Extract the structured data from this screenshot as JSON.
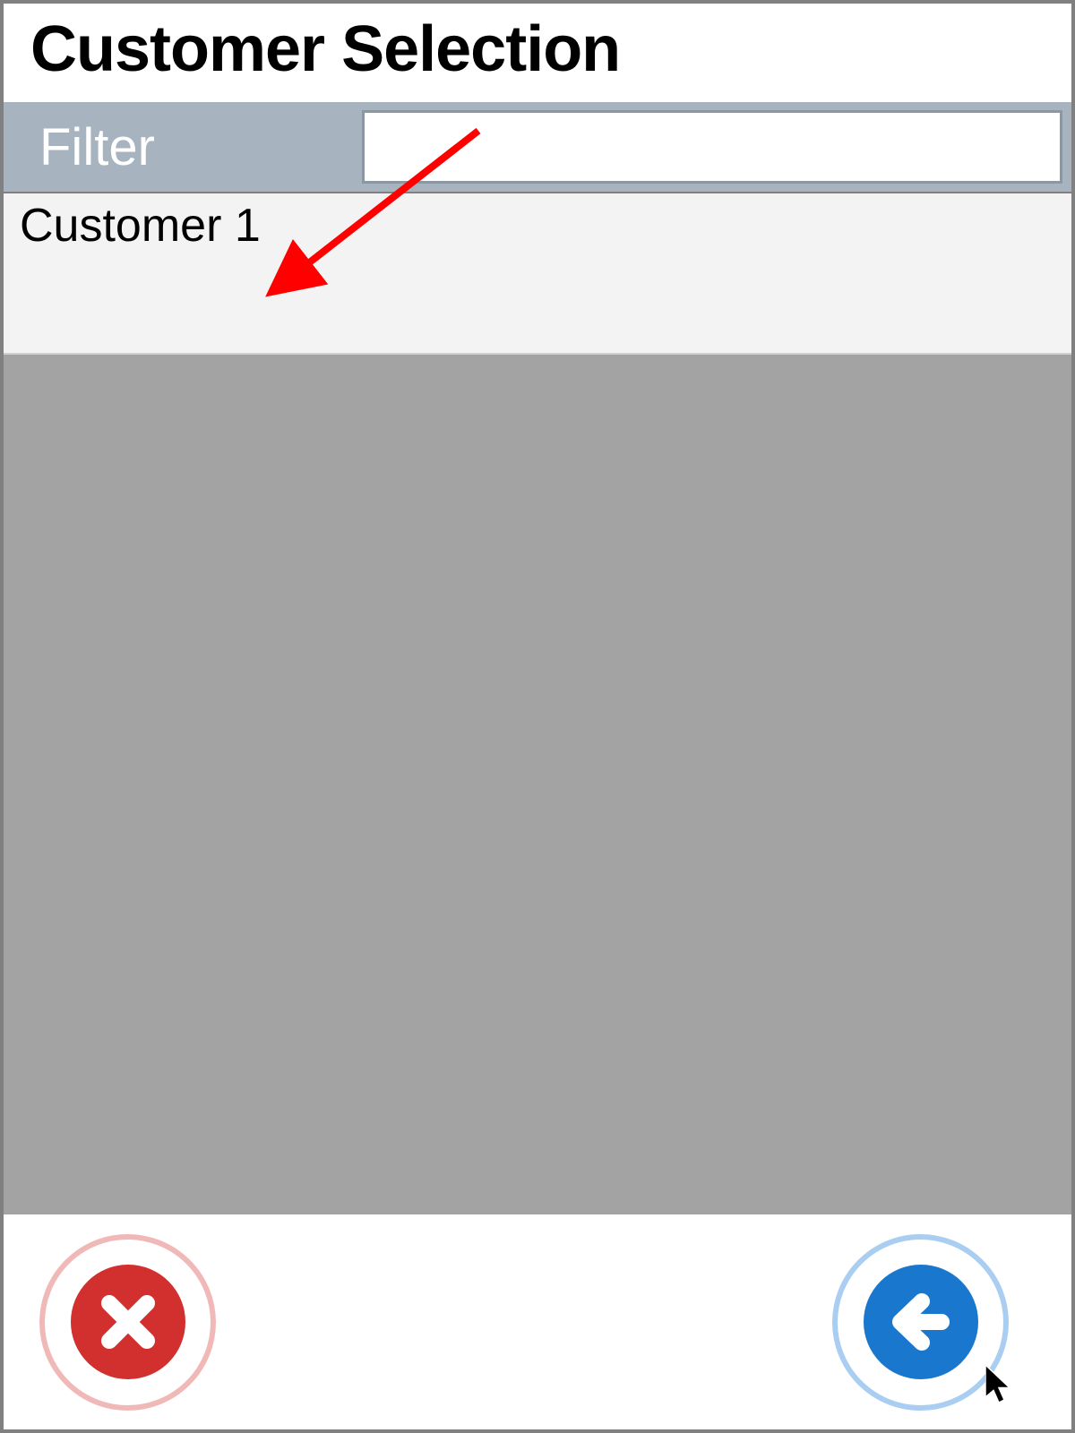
{
  "header": {
    "title": "Customer Selection"
  },
  "filter": {
    "label": "Filter",
    "value": ""
  },
  "list": {
    "items": [
      {
        "label": "Customer 1"
      }
    ]
  },
  "footer": {
    "cancel_icon": "close-x",
    "back_icon": "arrow-left"
  },
  "colors": {
    "header_bar": "#a7b4c0",
    "list_bg": "#a3a3a3",
    "item_bg": "#f3f3f3",
    "cancel": "#d22f2f",
    "back": "#1977cd",
    "annotation_arrow": "#ff0000"
  }
}
